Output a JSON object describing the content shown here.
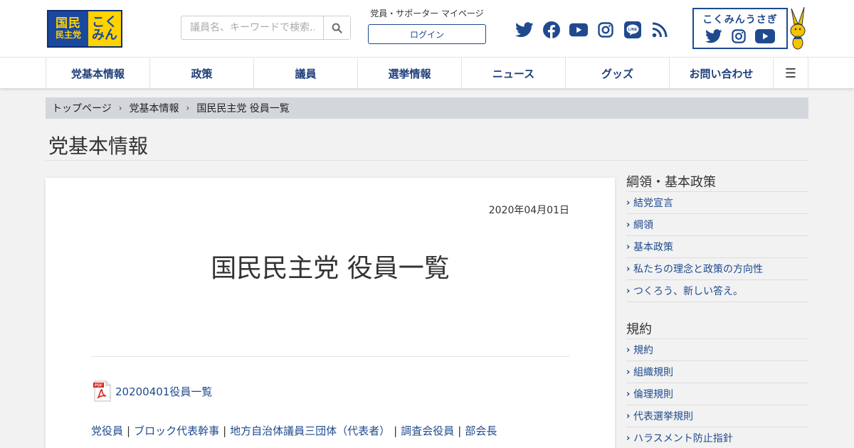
{
  "header": {
    "logo": {
      "left_line1": "国民",
      "left_line2": "民主党",
      "right_line1": "こく",
      "right_line2": "みん"
    },
    "search": {
      "placeholder": "議員名、キーワードで検索..."
    },
    "member": {
      "title": "党員・サポーター マイページ",
      "login_label": "ログイン"
    },
    "socials": [
      "twitter-icon",
      "facebook-icon",
      "youtube-icon",
      "instagram-icon",
      "line-icon",
      "rss-icon"
    ],
    "kokumin_usagi": {
      "title": "こくみんうさぎ"
    }
  },
  "nav": {
    "items": [
      "党基本情報",
      "政策",
      "議員",
      "選挙情報",
      "ニュース",
      "グッズ",
      "お問い合わせ"
    ],
    "menu_icon": "☰"
  },
  "breadcrumb": {
    "items": [
      "トップページ",
      "党基本情報",
      "国民民主党 役員一覧"
    ],
    "separator": "›"
  },
  "page": {
    "title": "党基本情報"
  },
  "post": {
    "date": "2020年04月01日",
    "title": "国民民主党 役員一覧",
    "pdf_link": "20200401役員一覧",
    "links": [
      "党役員",
      "ブロック代表幹事",
      "地方自治体議員三団体（代表者）",
      "調査会役員",
      "部会長"
    ],
    "links_separator": "|"
  },
  "sidebar": {
    "sections": [
      {
        "heading": "綱領・基本政策",
        "items": [
          "結党宣言",
          "綱領",
          "基本政策",
          "私たちの理念と政策の方向性",
          "つくろう、新しい答え。"
        ]
      },
      {
        "heading": "規約",
        "items": [
          "規約",
          "組織規則",
          "倫理規則",
          "代表選挙規則",
          "ハラスメント防止指針"
        ]
      }
    ]
  },
  "colors": {
    "brand_blue": "#1f4a8e",
    "logo_yellow": "#ffd200",
    "nav_text": "#1f3f7a",
    "breadcrumb_bg": "#d3d7dc"
  }
}
